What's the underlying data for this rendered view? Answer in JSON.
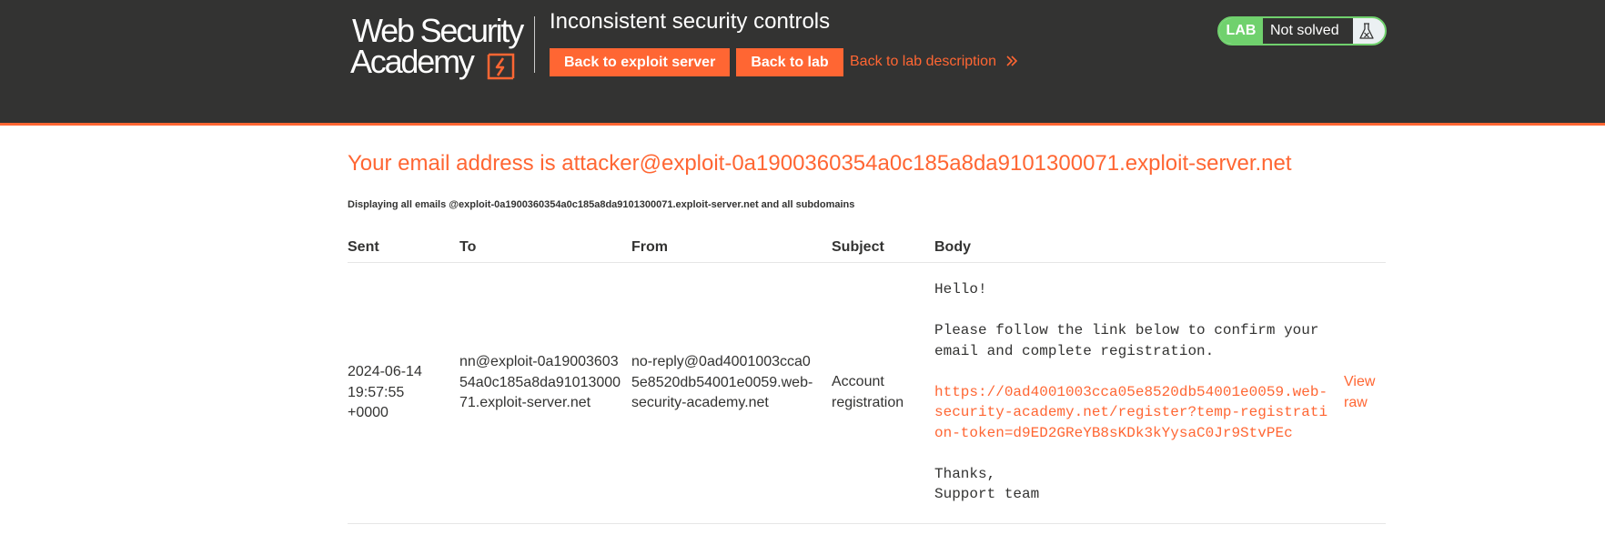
{
  "header": {
    "logo_line1": "Web Security",
    "logo_line2": "Academy",
    "lab_title": "Inconsistent security controls",
    "btn_exploit": "Back to exploit server",
    "btn_lab": "Back to lab",
    "desc_link": "Back to lab description",
    "status_lab": "LAB",
    "status_text": "Not solved",
    "status_icon": "flask-icon"
  },
  "main": {
    "heading": "Your email address is attacker@exploit-0a1900360354a0c185a8da9101300071.exploit-server.net",
    "note": "Displaying all emails @exploit-0a1900360354a0c185a8da9101300071.exploit-server.net and all subdomains"
  },
  "table": {
    "headers": {
      "sent": "Sent",
      "to": "To",
      "from": "From",
      "subject": "Subject",
      "body": "Body"
    },
    "rows": [
      {
        "sent": "2024-06-14 19:57:55 +0000",
        "to": "nn@exploit-0a1900360354a0c185a8da9101300071.exploit-server.net",
        "from": "no-reply@0ad4001003cca05e8520db54001e0059.web-security-academy.net",
        "subject": "Account registration",
        "body_intro": "Hello!\n\nPlease follow the link below to confirm your email and complete registration.\n\n",
        "body_link": "https://0ad4001003cca05e8520db54001e0059.web-security-academy.net/register?temp-registration-token=d9ED2GReYB8sKDk3kYysaC0Jr9StvPEc",
        "body_outro": "\n\nThanks,\nSupport team",
        "view_raw": "View raw"
      }
    ]
  },
  "colors": {
    "brand": "#ff6633",
    "header_bg": "#333332",
    "solved_green": "#70d16d"
  }
}
